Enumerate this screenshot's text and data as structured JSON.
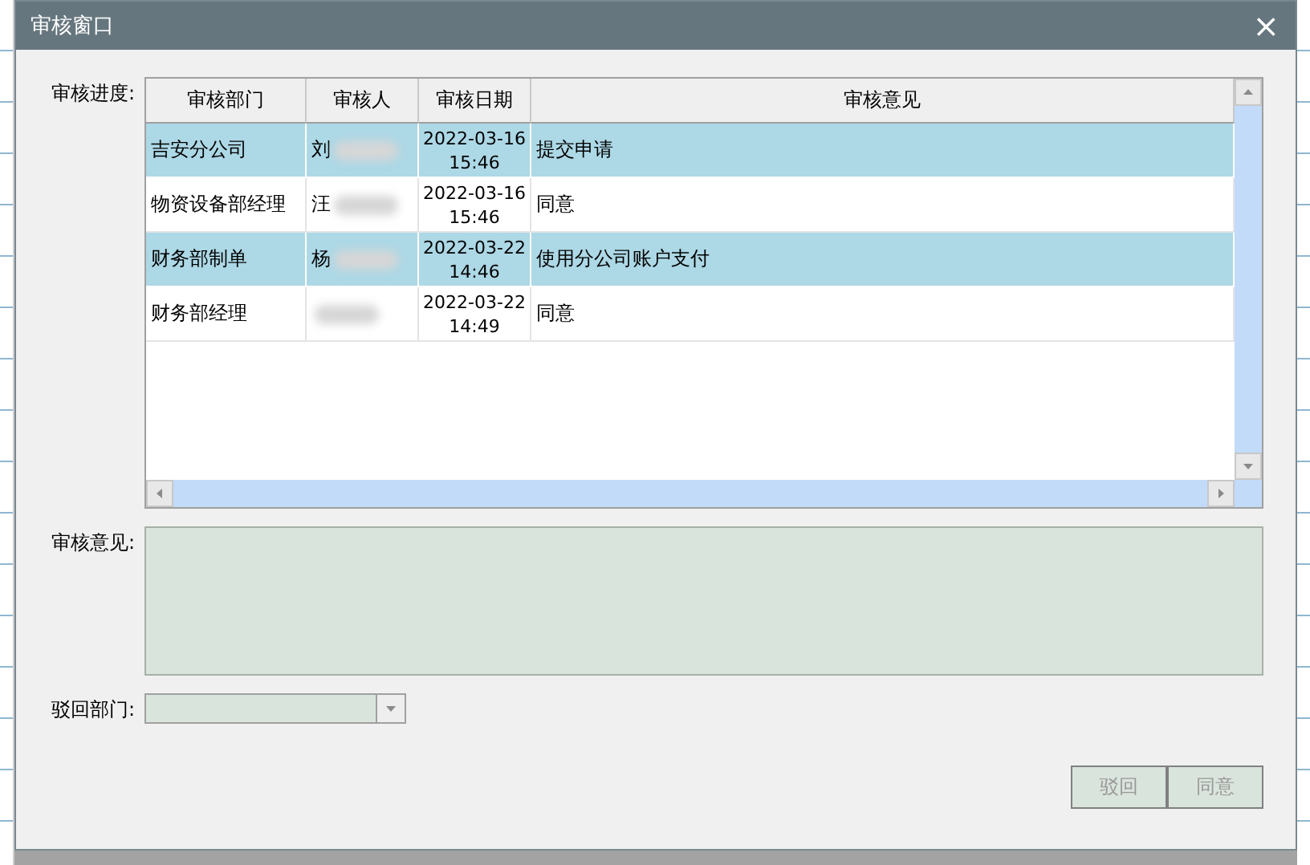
{
  "window": {
    "title": "审核窗口",
    "close": "×"
  },
  "progress": {
    "label": "审核进度:",
    "columns": [
      "审核部门",
      "审核人",
      "审核日期",
      "审核意见"
    ],
    "rows": [
      {
        "department": "吉安分公司",
        "reviewer": "刘",
        "date": "2022-03-16",
        "time": "15:46",
        "opinion": "提交申请",
        "selected": true
      },
      {
        "department": "物资设备部经理",
        "reviewer": "汪",
        "date": "2022-03-16",
        "time": "15:46",
        "opinion": "同意",
        "selected": false
      },
      {
        "department": "财务部制单",
        "reviewer": "杨",
        "date": "2022-03-22",
        "time": "14:46",
        "opinion": "使用分公司账户支付",
        "selected": true
      },
      {
        "department": "财务部经理",
        "date": "2022-03-22",
        "time": "14:49",
        "opinion": "同意",
        "selected": false
      }
    ]
  },
  "opinion": {
    "label": "审核意见:",
    "disabled": true
  },
  "reject_department": {
    "label": "驳回部门:",
    "disabled": true
  },
  "buttons": [
    {
      "label": "驳回",
      "disabled": true
    },
    {
      "label": "同意",
      "disabled": true
    }
  ]
}
